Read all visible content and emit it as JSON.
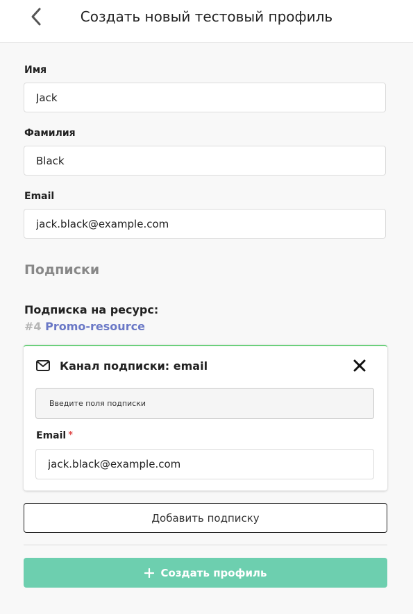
{
  "header": {
    "back_icon": "chevron-left-icon",
    "title": "Создать новый тестовый профиль"
  },
  "form": {
    "first_name": {
      "label": "Имя",
      "value": "Jack"
    },
    "last_name": {
      "label": "Фамилия",
      "value": "Black"
    },
    "email": {
      "label": "Email",
      "value": "jack.black@example.com"
    }
  },
  "subscriptions": {
    "section_title": "Подписки",
    "resource_label": "Подписка на ресурс:",
    "resource_number": "#4",
    "resource_name": "Promo-resource",
    "channel_card": {
      "icon": "envelope-icon",
      "title": "Канал подписки: email",
      "close_icon": "close-icon",
      "hint": "Введите поля подписки",
      "email_label": "Email",
      "required_mark": "*",
      "email_value": "jack.black@example.com",
      "accent_color": "#6cd07c"
    },
    "add_button_label": "Добавить подписку"
  },
  "create_button": {
    "icon": "plus-icon",
    "label": "Создать профиль",
    "color": "#6dcfaf"
  }
}
